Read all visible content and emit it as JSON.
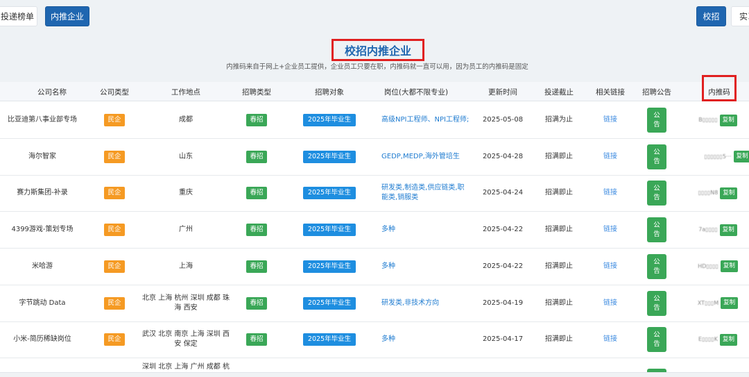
{
  "nav": {
    "left_buttons": [
      "投递榜单",
      "内推企业"
    ],
    "right_buttons": [
      "校招",
      "实习"
    ]
  },
  "title": "校招内推企业",
  "subtitle": "内推码来自于网上+企业员工提供，企业员工只要在职，内推码就一直可以用，因为员工的内推码是固定",
  "columns": [
    "公司名称",
    "公司类型",
    "工作地点",
    "招聘类型",
    "招聘对象",
    "岗位(大都不限专业)",
    "更新时间",
    "投递截止",
    "相关链接",
    "招聘公告",
    "内推码"
  ],
  "rows": [
    {
      "company": "比亚迪第八事业部专场",
      "type": "民企",
      "location": "成都",
      "recruit_type": "春招",
      "target": "2025年毕业生",
      "positions": "高级NPI工程师、NPI工程师;",
      "updated": "2025-05-08",
      "deadline": "招满为止",
      "link": "链接",
      "notice": [
        "公",
        "告"
      ],
      "code": "B▯▯▯▯▯",
      "copy": "复制"
    },
    {
      "company": "海尔智家",
      "type": "民企",
      "location": "山东",
      "recruit_type": "春招",
      "target": "2025年毕业生",
      "positions": "GEDP,MEDP,海外管培生",
      "updated": "2025-04-28",
      "deadline": "招满即止",
      "link": "链接",
      "notice": [
        "公",
        "告"
      ],
      "code": "▯▯▯▯▯▯5···",
      "copy": "复制"
    },
    {
      "company": "赛力斯集团-补录",
      "type": "民企",
      "location": "重庆",
      "recruit_type": "春招",
      "target": "2025年毕业生",
      "positions": "研发类,制造类,供应链类,职能类,销服类",
      "updated": "2025-04-24",
      "deadline": "招满即止",
      "link": "链接",
      "notice": [
        "公",
        "告"
      ],
      "code": "▯▯▯▯N8",
      "copy": "复制"
    },
    {
      "company": "4399游戏-策划专场",
      "type": "民企",
      "location": "广州",
      "recruit_type": "春招",
      "target": "2025年毕业生",
      "positions": "多种",
      "updated": "2025-04-22",
      "deadline": "招满即止",
      "link": "链接",
      "notice": [
        "公",
        "告"
      ],
      "code": "7a▯▯▯▯",
      "copy": "复制"
    },
    {
      "company": "米哈游",
      "type": "民企",
      "location": "上海",
      "recruit_type": "春招",
      "target": "2025年毕业生",
      "positions": "多种",
      "updated": "2025-04-22",
      "deadline": "招满即止",
      "link": "链接",
      "notice": [
        "公",
        "告"
      ],
      "code": "HD▯▯▯▯",
      "copy": "复制"
    },
    {
      "company": "字节跳动 Data",
      "type": "民企",
      "location": "北京 上海 杭州 深圳 成都 珠海 西安",
      "recruit_type": "春招",
      "target": "2025年毕业生",
      "positions": "研发类,非技术方向",
      "updated": "2025-04-19",
      "deadline": "招满即止",
      "link": "链接",
      "notice": [
        "公",
        "告"
      ],
      "code": "XT▯▯▯M",
      "copy": "复制"
    },
    {
      "company": "小米-简历稀缺岗位",
      "type": "民企",
      "location": "武汉 北京 南京 上海 深圳 西安 保定",
      "recruit_type": "春招",
      "target": "2025年毕业生",
      "positions": "多种",
      "updated": "2025-04-17",
      "deadline": "招满即止",
      "link": "链接",
      "notice": [
        "公",
        "告"
      ],
      "code": "E▯▯▯▯K",
      "copy": "复制"
    },
    {
      "company": "",
      "type": "",
      "location": "深圳 北京 上海 广州 成都 杭",
      "recruit_type": "",
      "target": "",
      "positions": "",
      "updated": "",
      "deadline": "",
      "link": "",
      "notice": [
        "公",
        ""
      ],
      "code": "",
      "copy": ""
    }
  ],
  "colors": {
    "brand_blue": "#1f66b0",
    "highlight_red": "#e02020",
    "tag_orange": "#f59a23",
    "tag_green": "#3aa757",
    "tag_blue": "#1e8ee0"
  }
}
